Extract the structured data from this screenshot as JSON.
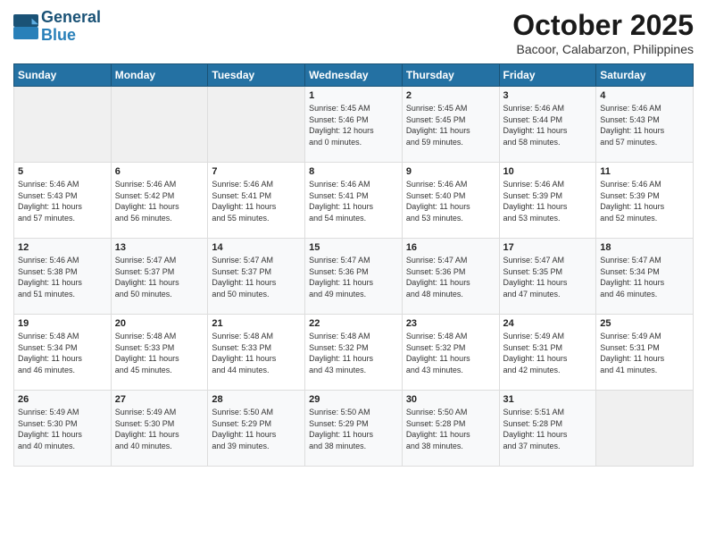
{
  "header": {
    "logo_line1": "General",
    "logo_line2": "Blue",
    "month_title": "October 2025",
    "location": "Bacoor, Calabarzon, Philippines"
  },
  "weekdays": [
    "Sunday",
    "Monday",
    "Tuesday",
    "Wednesday",
    "Thursday",
    "Friday",
    "Saturday"
  ],
  "weeks": [
    [
      {
        "day": "",
        "info": ""
      },
      {
        "day": "",
        "info": ""
      },
      {
        "day": "",
        "info": ""
      },
      {
        "day": "1",
        "info": "Sunrise: 5:45 AM\nSunset: 5:46 PM\nDaylight: 12 hours\nand 0 minutes."
      },
      {
        "day": "2",
        "info": "Sunrise: 5:45 AM\nSunset: 5:45 PM\nDaylight: 11 hours\nand 59 minutes."
      },
      {
        "day": "3",
        "info": "Sunrise: 5:46 AM\nSunset: 5:44 PM\nDaylight: 11 hours\nand 58 minutes."
      },
      {
        "day": "4",
        "info": "Sunrise: 5:46 AM\nSunset: 5:43 PM\nDaylight: 11 hours\nand 57 minutes."
      }
    ],
    [
      {
        "day": "5",
        "info": "Sunrise: 5:46 AM\nSunset: 5:43 PM\nDaylight: 11 hours\nand 57 minutes."
      },
      {
        "day": "6",
        "info": "Sunrise: 5:46 AM\nSunset: 5:42 PM\nDaylight: 11 hours\nand 56 minutes."
      },
      {
        "day": "7",
        "info": "Sunrise: 5:46 AM\nSunset: 5:41 PM\nDaylight: 11 hours\nand 55 minutes."
      },
      {
        "day": "8",
        "info": "Sunrise: 5:46 AM\nSunset: 5:41 PM\nDaylight: 11 hours\nand 54 minutes."
      },
      {
        "day": "9",
        "info": "Sunrise: 5:46 AM\nSunset: 5:40 PM\nDaylight: 11 hours\nand 53 minutes."
      },
      {
        "day": "10",
        "info": "Sunrise: 5:46 AM\nSunset: 5:39 PM\nDaylight: 11 hours\nand 53 minutes."
      },
      {
        "day": "11",
        "info": "Sunrise: 5:46 AM\nSunset: 5:39 PM\nDaylight: 11 hours\nand 52 minutes."
      }
    ],
    [
      {
        "day": "12",
        "info": "Sunrise: 5:46 AM\nSunset: 5:38 PM\nDaylight: 11 hours\nand 51 minutes."
      },
      {
        "day": "13",
        "info": "Sunrise: 5:47 AM\nSunset: 5:37 PM\nDaylight: 11 hours\nand 50 minutes."
      },
      {
        "day": "14",
        "info": "Sunrise: 5:47 AM\nSunset: 5:37 PM\nDaylight: 11 hours\nand 50 minutes."
      },
      {
        "day": "15",
        "info": "Sunrise: 5:47 AM\nSunset: 5:36 PM\nDaylight: 11 hours\nand 49 minutes."
      },
      {
        "day": "16",
        "info": "Sunrise: 5:47 AM\nSunset: 5:36 PM\nDaylight: 11 hours\nand 48 minutes."
      },
      {
        "day": "17",
        "info": "Sunrise: 5:47 AM\nSunset: 5:35 PM\nDaylight: 11 hours\nand 47 minutes."
      },
      {
        "day": "18",
        "info": "Sunrise: 5:47 AM\nSunset: 5:34 PM\nDaylight: 11 hours\nand 46 minutes."
      }
    ],
    [
      {
        "day": "19",
        "info": "Sunrise: 5:48 AM\nSunset: 5:34 PM\nDaylight: 11 hours\nand 46 minutes."
      },
      {
        "day": "20",
        "info": "Sunrise: 5:48 AM\nSunset: 5:33 PM\nDaylight: 11 hours\nand 45 minutes."
      },
      {
        "day": "21",
        "info": "Sunrise: 5:48 AM\nSunset: 5:33 PM\nDaylight: 11 hours\nand 44 minutes."
      },
      {
        "day": "22",
        "info": "Sunrise: 5:48 AM\nSunset: 5:32 PM\nDaylight: 11 hours\nand 43 minutes."
      },
      {
        "day": "23",
        "info": "Sunrise: 5:48 AM\nSunset: 5:32 PM\nDaylight: 11 hours\nand 43 minutes."
      },
      {
        "day": "24",
        "info": "Sunrise: 5:49 AM\nSunset: 5:31 PM\nDaylight: 11 hours\nand 42 minutes."
      },
      {
        "day": "25",
        "info": "Sunrise: 5:49 AM\nSunset: 5:31 PM\nDaylight: 11 hours\nand 41 minutes."
      }
    ],
    [
      {
        "day": "26",
        "info": "Sunrise: 5:49 AM\nSunset: 5:30 PM\nDaylight: 11 hours\nand 40 minutes."
      },
      {
        "day": "27",
        "info": "Sunrise: 5:49 AM\nSunset: 5:30 PM\nDaylight: 11 hours\nand 40 minutes."
      },
      {
        "day": "28",
        "info": "Sunrise: 5:50 AM\nSunset: 5:29 PM\nDaylight: 11 hours\nand 39 minutes."
      },
      {
        "day": "29",
        "info": "Sunrise: 5:50 AM\nSunset: 5:29 PM\nDaylight: 11 hours\nand 38 minutes."
      },
      {
        "day": "30",
        "info": "Sunrise: 5:50 AM\nSunset: 5:28 PM\nDaylight: 11 hours\nand 38 minutes."
      },
      {
        "day": "31",
        "info": "Sunrise: 5:51 AM\nSunset: 5:28 PM\nDaylight: 11 hours\nand 37 minutes."
      },
      {
        "day": "",
        "info": ""
      }
    ]
  ]
}
